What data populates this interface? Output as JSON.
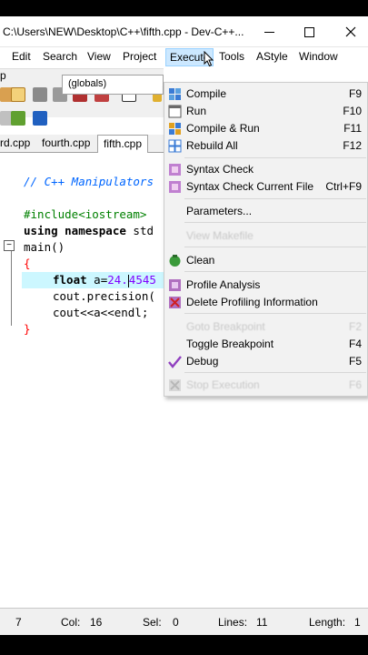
{
  "window": {
    "title": "C:\\Users\\NEW\\Desktop\\C++\\fifth.cpp - Dev-C++..."
  },
  "menubar": {
    "items": [
      "Edit",
      "Search",
      "View",
      "Project",
      "Execute",
      "Tools",
      "AStyle",
      "Window"
    ],
    "partial_left": "p"
  },
  "toolbar": {
    "scope_select": "(globals)"
  },
  "tabs": [
    "rd.cpp",
    "fourth.cpp",
    "fifth.cpp"
  ],
  "editor": {
    "lines": {
      "comment": "// C++ Manipulators",
      "include": "#include<iostream>",
      "using_kw": "using namespace",
      "using_rest": " std",
      "main": "main()",
      "open_brace": "{",
      "float_kw": "float",
      "float_var": " a=",
      "float_num_a": "24.",
      "float_num_b": "4545",
      "precision": "cout.precision(",
      "cout": "cout<<a<<endl;",
      "close_brace": "}"
    },
    "fold_symbol": "⊟"
  },
  "execute_menu": {
    "items": [
      {
        "label": "Compile",
        "shortcut": "F9",
        "icon": "compile-icon",
        "enabled": true
      },
      {
        "label": "Run",
        "shortcut": "F10",
        "icon": "run-icon",
        "enabled": true
      },
      {
        "label": "Compile & Run",
        "shortcut": "F11",
        "icon": "compile-run-icon",
        "enabled": true
      },
      {
        "label": "Rebuild All",
        "shortcut": "F12",
        "icon": "rebuild-icon",
        "enabled": true
      },
      {
        "label": "Syntax Check",
        "shortcut": "",
        "icon": "syntax-check-icon",
        "enabled": true
      },
      {
        "label": "Syntax Check Current File",
        "shortcut": "Ctrl+F9",
        "icon": "syntax-check-file-icon",
        "enabled": true
      },
      {
        "label": "Parameters...",
        "shortcut": "",
        "icon": "",
        "enabled": true
      },
      {
        "label": "View Makefile",
        "shortcut": "",
        "icon": "",
        "enabled": false
      },
      {
        "label": "Clean",
        "shortcut": "",
        "icon": "clean-icon",
        "enabled": true
      },
      {
        "label": "Profile Analysis",
        "shortcut": "",
        "icon": "profile-icon",
        "enabled": true
      },
      {
        "label": "Delete Profiling Information",
        "shortcut": "",
        "icon": "delete-profile-icon",
        "enabled": true
      },
      {
        "label": "Goto Breakpoint",
        "shortcut": "F2",
        "icon": "",
        "enabled": false
      },
      {
        "label": "Toggle Breakpoint",
        "shortcut": "F4",
        "icon": "",
        "enabled": true
      },
      {
        "label": "Debug",
        "shortcut": "F5",
        "icon": "debug-icon",
        "enabled": true
      },
      {
        "label": "Stop Execution",
        "shortcut": "F6",
        "icon": "stop-icon",
        "enabled": false
      }
    ]
  },
  "statusbar": {
    "line_value": "7",
    "col_label": "Col:",
    "col_value": "16",
    "sel_label": "Sel:",
    "sel_value": "0",
    "lines_label": "Lines:",
    "lines_value": "11",
    "length_label": "Length:",
    "length_value": "1"
  },
  "colors": {
    "menu_highlight": "#cce8ff",
    "comment": "#0066ff",
    "brace": "#ff0000",
    "number": "#8000ff",
    "current_line": "#ccf7ff"
  }
}
